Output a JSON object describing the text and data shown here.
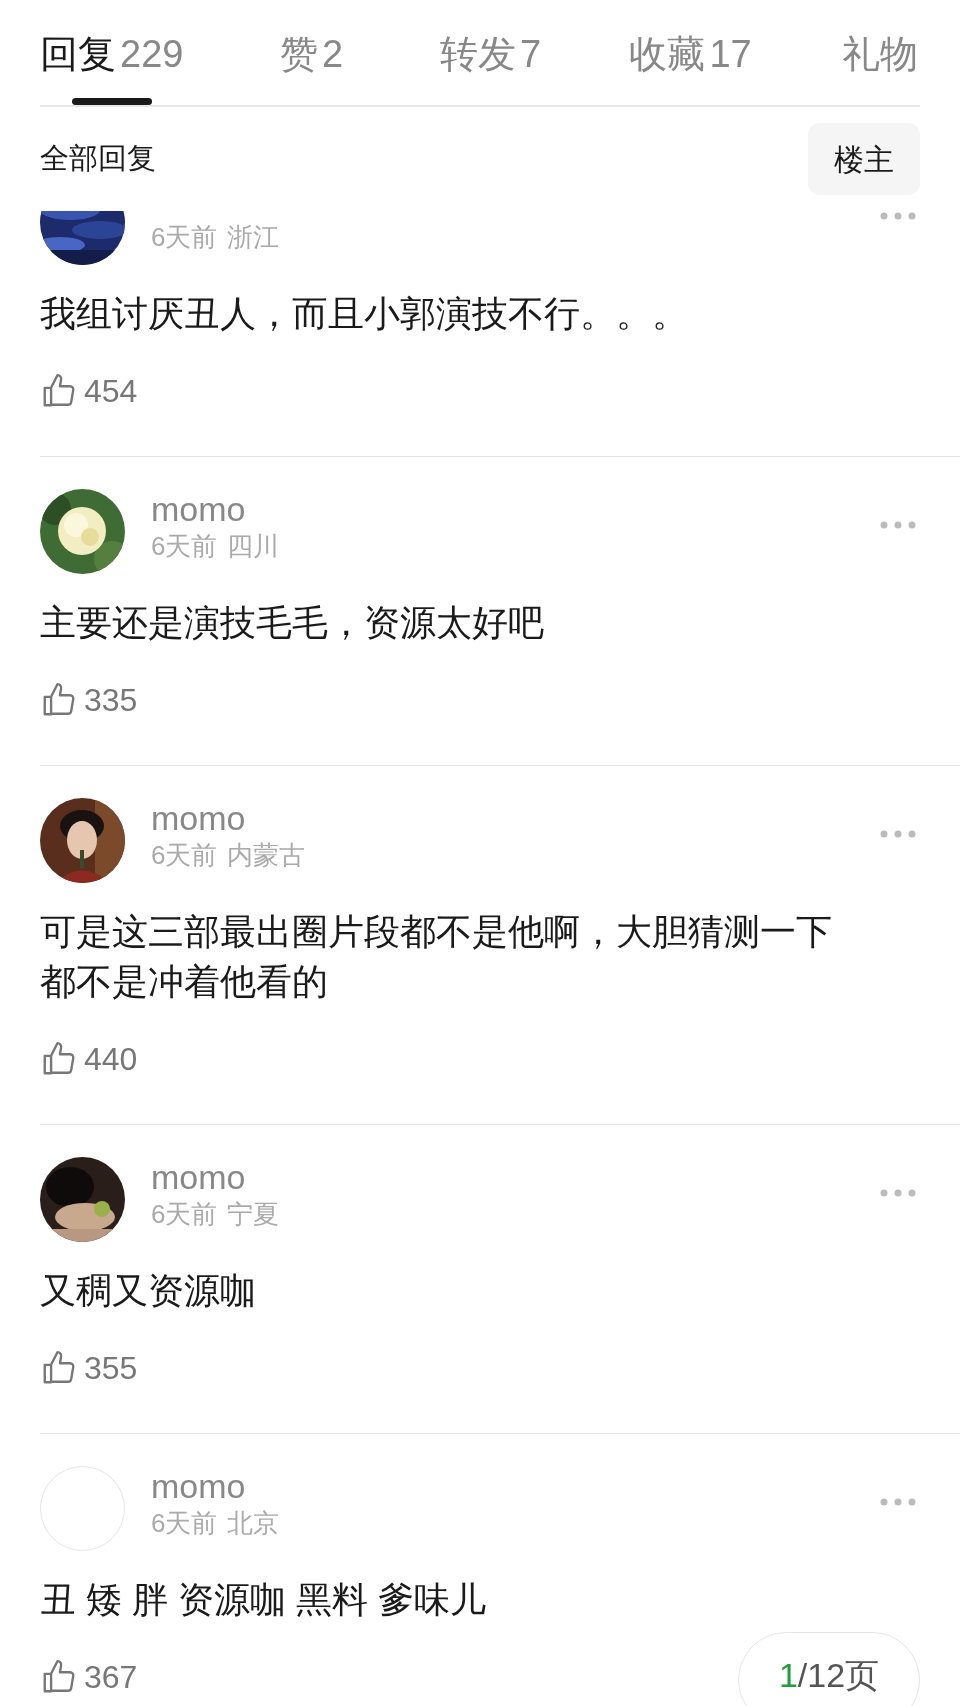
{
  "tabs": [
    {
      "label": "回复",
      "count": "229",
      "selected": true
    },
    {
      "label": "赞",
      "count": "2",
      "selected": false
    },
    {
      "label": "转发",
      "count": "7",
      "selected": false
    },
    {
      "label": "收藏",
      "count": "17",
      "selected": false
    },
    {
      "label": "礼物",
      "selected": false
    }
  ],
  "filter": {
    "title": "全部回复",
    "button": "楼主"
  },
  "comments": [
    {
      "time": "6天前",
      "place": "浙江",
      "text": "我组讨厌丑人，而且小郭演技不行。。。",
      "likes": "454"
    },
    {
      "name": "momo",
      "time": "6天前",
      "place": "四川",
      "text": "主要还是演技毛毛，资源太好吧",
      "likes": "335"
    },
    {
      "name": "momo",
      "time": "6天前",
      "place": "内蒙古",
      "text": "可是这三部最出圈片段都不是他啊，大胆猜测一下都不是冲着他看的",
      "likes": "440"
    },
    {
      "name": "momo",
      "time": "6天前",
      "place": "宁夏",
      "text": "又稠又资源咖",
      "likes": "355"
    },
    {
      "avatar": {
        "kind": "empty"
      },
      "name": "momo",
      "time": "6天前",
      "place": "北京",
      "text": "丑 矮 胖 资源咖 黑料 爹味儿",
      "likes": "367"
    }
  ],
  "pager": {
    "current": "1",
    "total": "/12页"
  }
}
